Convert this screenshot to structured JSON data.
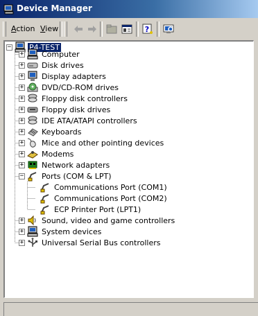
{
  "window": {
    "title": "Device Manager",
    "icon": "device-manager-icon"
  },
  "menu": {
    "action_pre": "",
    "action_ul": "A",
    "action_post": "ction",
    "view_pre": "",
    "view_ul": "V",
    "view_post": "iew"
  },
  "toolbar_buttons": [
    "back-arrow-icon",
    "forward-arrow-icon",
    "up-folder-icon",
    "properties-icon",
    "help-icon",
    "scan-hardware-icon"
  ],
  "tree": {
    "root": {
      "label": "P4-TEST",
      "icon": "computer-icon",
      "expanded": true,
      "selected": true
    },
    "categories": [
      {
        "label": "Computer",
        "icon": "computer-icon"
      },
      {
        "label": "Disk drives",
        "icon": "disk-drive-icon"
      },
      {
        "label": "Display adapters",
        "icon": "display-adapter-icon"
      },
      {
        "label": "DVD/CD-ROM drives",
        "icon": "cdrom-icon"
      },
      {
        "label": "Floppy disk controllers",
        "icon": "floppy-controller-icon"
      },
      {
        "label": "Floppy disk drives",
        "icon": "floppy-drive-icon"
      },
      {
        "label": "IDE ATA/ATAPI controllers",
        "icon": "ide-controller-icon"
      },
      {
        "label": "Keyboards",
        "icon": "keyboard-icon"
      },
      {
        "label": "Mice and other pointing devices",
        "icon": "mouse-icon"
      },
      {
        "label": "Modems",
        "icon": "modem-icon"
      },
      {
        "label": "Network adapters",
        "icon": "network-adapter-icon"
      },
      {
        "label": "Ports (COM & LPT)",
        "icon": "port-icon",
        "expanded": true,
        "children": [
          {
            "label": "Communications Port (COM1)",
            "icon": "port-icon"
          },
          {
            "label": "Communications Port (COM2)",
            "icon": "port-icon"
          },
          {
            "label": "ECP Printer Port (LPT1)",
            "icon": "port-icon"
          }
        ]
      },
      {
        "label": "Sound, video and game controllers",
        "icon": "sound-icon"
      },
      {
        "label": "System devices",
        "icon": "system-devices-icon"
      },
      {
        "label": "Universal Serial Bus controllers",
        "icon": "usb-icon"
      }
    ]
  },
  "status_bar": {
    "text": ""
  }
}
